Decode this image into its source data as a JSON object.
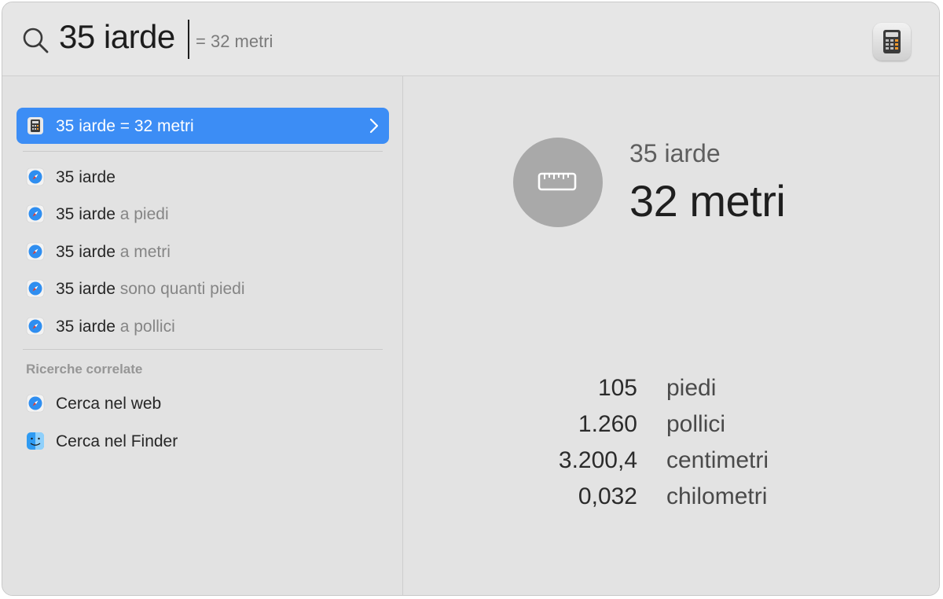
{
  "search": {
    "query": "35 iarde",
    "inline_result": "= 32 metri",
    "app_icon": "calculator-icon"
  },
  "results": {
    "top_hit": {
      "label": "35 iarde = 32 metri",
      "icon": "calculator-icon"
    },
    "suggestions": [
      {
        "bold": "35 iarde",
        "rest": "",
        "icon": "safari-icon"
      },
      {
        "bold": "35 iarde",
        "rest": " a piedi",
        "icon": "safari-icon"
      },
      {
        "bold": "35 iarde",
        "rest": " a metri",
        "icon": "safari-icon"
      },
      {
        "bold": "35 iarde",
        "rest": " sono quanti piedi",
        "icon": "safari-icon"
      },
      {
        "bold": "35 iarde",
        "rest": " a pollici",
        "icon": "safari-icon"
      }
    ],
    "related_title": "Ricerche correlate",
    "related": [
      {
        "label": "Cerca nel web",
        "icon": "safari-icon"
      },
      {
        "label": "Cerca nel Finder",
        "icon": "finder-icon"
      }
    ]
  },
  "detail": {
    "icon": "ruler-icon",
    "from": "35 iarde",
    "to": "32 metri",
    "conversions": [
      {
        "value": "105",
        "unit": "piedi"
      },
      {
        "value": "1.260",
        "unit": "pollici"
      },
      {
        "value": "3.200,4",
        "unit": "centimetri"
      },
      {
        "value": "0,032",
        "unit": "chilometri"
      }
    ]
  },
  "colors": {
    "selection": "#3c8df5",
    "background": "#e3e3e3"
  }
}
